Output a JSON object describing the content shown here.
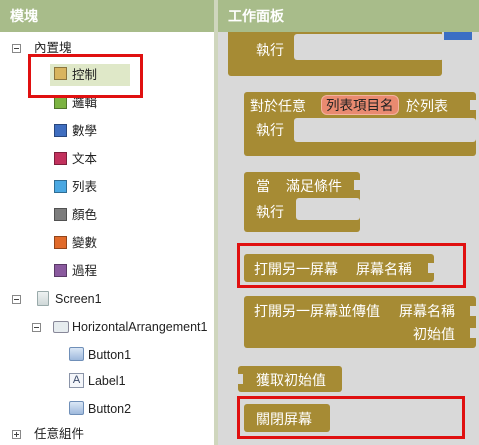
{
  "blocks_panel": {
    "title": "模塊",
    "builtin_label": "內置塊",
    "categories": [
      {
        "label": "控制",
        "color": "#d8b45e"
      },
      {
        "label": "邏輯",
        "color": "#7cb342"
      },
      {
        "label": "數學",
        "color": "#3f6ec0"
      },
      {
        "label": "文本",
        "color": "#c2315d"
      },
      {
        "label": "列表",
        "color": "#4aa8e2"
      },
      {
        "label": "顏色",
        "color": "#7d7d7d"
      },
      {
        "label": "變數",
        "color": "#e16a2a"
      },
      {
        "label": "過程",
        "color": "#8a5a9e"
      }
    ],
    "screen_label": "Screen1",
    "arrangement_label": "HorizontalArrangement1",
    "components": [
      "Button1",
      "Label1",
      "Button2"
    ],
    "any_component_label": "任意組件"
  },
  "workspace": {
    "title": "工作面板",
    "block1": {
      "do_label": "執行"
    },
    "block2": {
      "prefix": "對於任意",
      "var_name": "列表項目名",
      "suffix": "於列表",
      "do_label": "執行"
    },
    "block3": {
      "when_label": "當",
      "cond_label": "滿足條件",
      "do_label": "執行"
    },
    "block4": {
      "label": "打開另一屏幕",
      "param": "屏幕名稱"
    },
    "block5": {
      "label": "打開另一屏幕並傳值",
      "param1": "屏幕名稱",
      "param2": "初始值"
    },
    "block6": {
      "label": "獲取初始值"
    },
    "block7": {
      "label": "關閉屏幕"
    }
  },
  "colors": {
    "header": "#a8bc8a",
    "block": "#a68b34",
    "workspace": "#d9d9d9",
    "highlight": "#e01010",
    "var_pill": "#e98a70"
  }
}
